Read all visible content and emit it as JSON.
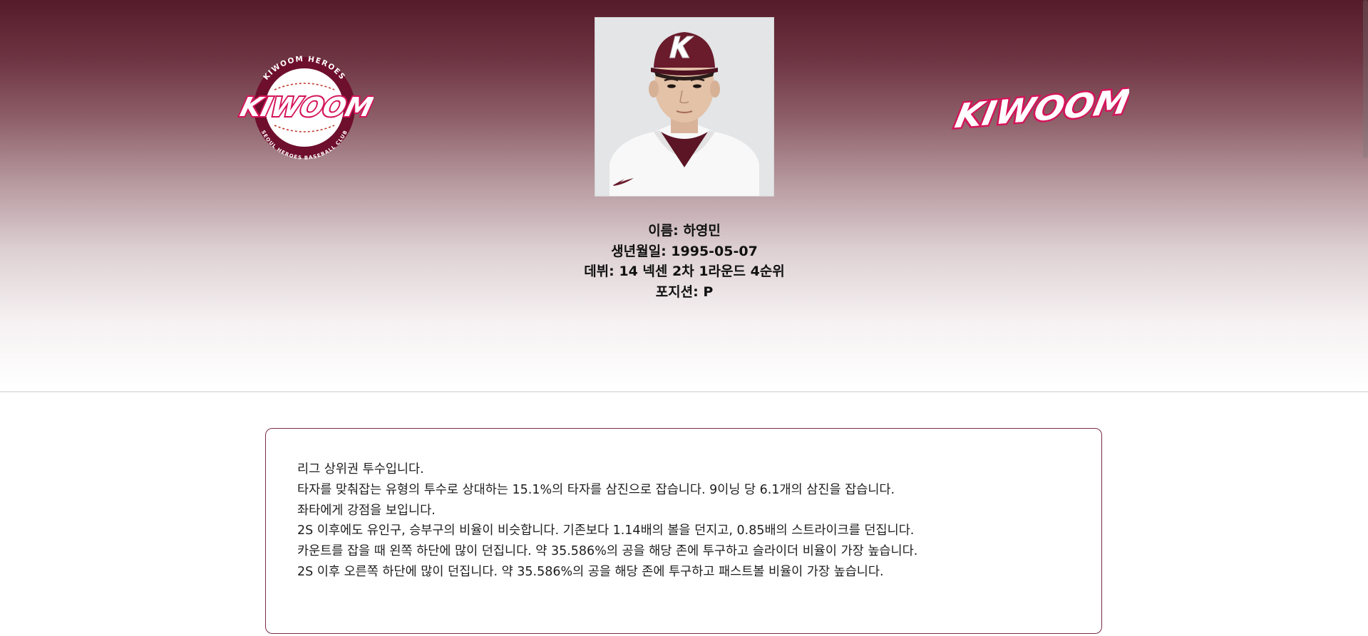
{
  "header": {
    "logo_left_icon": "kiwoom-heroes-emblem-icon",
    "logo_left_text": {
      "wordmark": "KIWOOM",
      "ring_top": "KIWOOM HEROES",
      "ring_bottom": "SEOUL HEROES BASEBALL CLUB"
    },
    "logo_right_icon": "kiwoom-wordmark-icon",
    "logo_right_text": "KIWOOM",
    "photo_icon": "player-photo-icon",
    "player": {
      "name": "이름: 하영민",
      "birth": "생년월일: 1995-05-07",
      "debut": "데뷔: 14 넥센 2차 1라운드 4순위",
      "position": "포지션: P"
    }
  },
  "report": {
    "lines": [
      "리그 상위권 투수입니다.",
      "타자를 맞춰잡는 유형의 투수로 상대하는 15.1%의 타자를 삼진으로 잡습니다. 9이닝 당 6.1개의 삼진을 잡습니다.",
      "좌타에게 강점을 보입니다.",
      "2S 이후에도 유인구, 승부구의 비율이 비슷합니다. 기존보다 1.14배의 볼을 던지고, 0.85배의 스트라이크를 던집니다.",
      "카운트를 잡을 때 왼쪽 하단에 많이 던집니다. 약 35.586%의 공을 해당 존에 투구하고 슬라이더 비율이 가장 높습니다.",
      "2S 이후 오른쪽 하단에 많이 던집니다. 약 35.586%의 공을 해당 존에 투구하고 패스트볼 비율이 가장 높습니다."
    ]
  },
  "colors": {
    "brand_burgundy": "#561b2a",
    "card_border": "#7a2c44",
    "logo_pink": "#d4145a"
  }
}
